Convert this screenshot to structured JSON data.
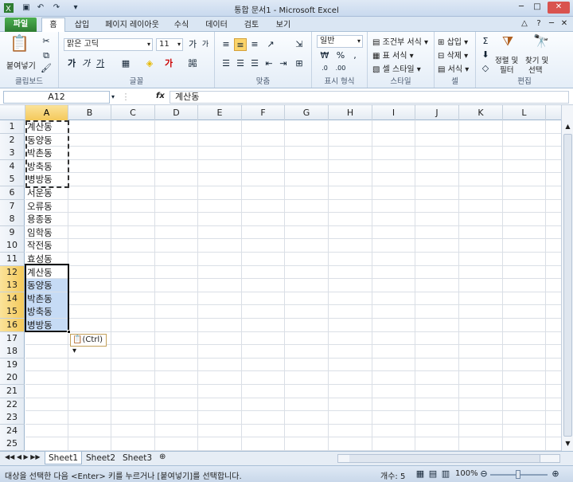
{
  "window": {
    "title": "통합 문서1 - Microsoft Excel"
  },
  "ribbon_tabs": [
    "파일",
    "홈",
    "삽입",
    "페이지 레이아웃",
    "수식",
    "데이터",
    "검토",
    "보기"
  ],
  "clipboard": {
    "paste_label": "붙여넣기",
    "group_label": "클립보드"
  },
  "font": {
    "name": "맑은 고딕",
    "size": "11",
    "group_label": "글꼴"
  },
  "alignment": {
    "group_label": "맞춤"
  },
  "number": {
    "format": "일반",
    "group_label": "표시 형식"
  },
  "styles": {
    "conditional": "조건부 서식",
    "table": "표 서식",
    "cell": "셀 스타일",
    "group_label": "스타일"
  },
  "cells": {
    "insert": "삽입",
    "delete": "삭제",
    "format": "서식",
    "group_label": "셀"
  },
  "editing": {
    "sort": "정렬 및",
    "sort2": "필터",
    "find": "찾기 및",
    "find2": "선택",
    "group_label": "편집"
  },
  "formula_bar": {
    "name_box": "A12",
    "fx": "fx",
    "content": "계산동"
  },
  "columns": [
    "A",
    "B",
    "C",
    "D",
    "E",
    "F",
    "G",
    "H",
    "I",
    "J",
    "K",
    "L"
  ],
  "rows": [
    "1",
    "2",
    "3",
    "4",
    "5",
    "6",
    "7",
    "8",
    "9",
    "10",
    "11",
    "12",
    "13",
    "14",
    "15",
    "16",
    "17",
    "18",
    "19",
    "20",
    "21",
    "22",
    "23",
    "24",
    "25"
  ],
  "cells_a": [
    "계산동",
    "동양동",
    "박촌동",
    "방축동",
    "병방동",
    "서운동",
    "오류동",
    "용종동",
    "임학동",
    "작전동",
    "효성동",
    "계산동",
    "동양동",
    "박촌동",
    "방축동",
    "병방동"
  ],
  "paste_options": {
    "label": "(Ctrl)"
  },
  "sheets": [
    "Sheet1",
    "Sheet2",
    "Sheet3"
  ],
  "status": {
    "message": "대상을 선택한 다음 <Enter> 키를 누르거나 [붙여넣기]를 선택합니다.",
    "count": "개수: 5",
    "zoom": "100%"
  },
  "colors": {
    "selection": "#c6dbf5",
    "header_selected": "#f4c95b",
    "file_tab": "#2e7d32"
  }
}
